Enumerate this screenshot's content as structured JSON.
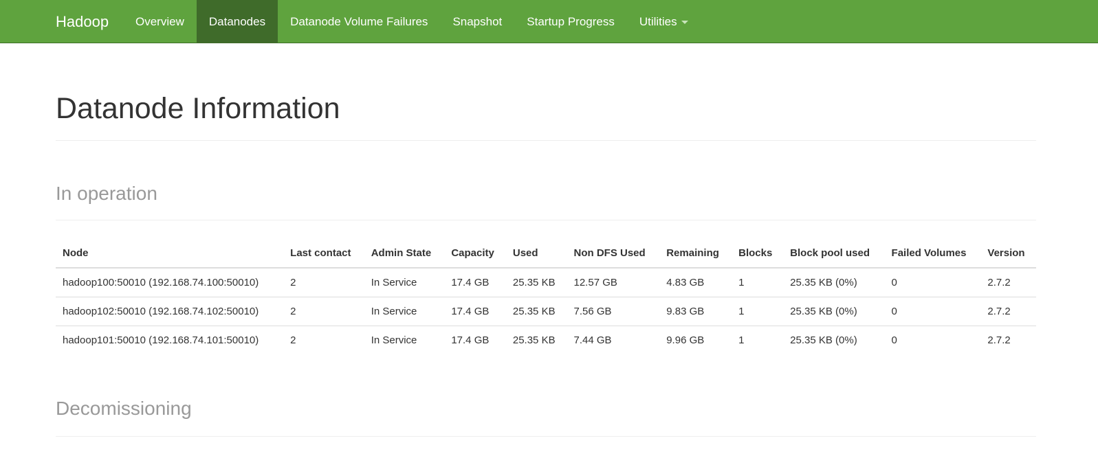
{
  "navbar": {
    "brand": "Hadoop",
    "items": [
      {
        "label": "Overview"
      },
      {
        "label": "Datanodes",
        "active": true
      },
      {
        "label": "Datanode Volume Failures"
      },
      {
        "label": "Snapshot"
      },
      {
        "label": "Startup Progress"
      },
      {
        "label": "Utilities",
        "has_dropdown": true
      }
    ]
  },
  "page": {
    "title": "Datanode Information"
  },
  "in_operation": {
    "title": "In operation",
    "columns": [
      "Node",
      "Last contact",
      "Admin State",
      "Capacity",
      "Used",
      "Non DFS Used",
      "Remaining",
      "Blocks",
      "Block pool used",
      "Failed Volumes",
      "Version"
    ],
    "rows": [
      [
        "hadoop100:50010 (192.168.74.100:50010)",
        "2",
        "In Service",
        "17.4 GB",
        "25.35 KB",
        "12.57 GB",
        "4.83 GB",
        "1",
        "25.35 KB (0%)",
        "0",
        "2.7.2"
      ],
      [
        "hadoop102:50010 (192.168.74.102:50010)",
        "2",
        "In Service",
        "17.4 GB",
        "25.35 KB",
        "7.56 GB",
        "9.83 GB",
        "1",
        "25.35 KB (0%)",
        "0",
        "2.7.2"
      ],
      [
        "hadoop101:50010 (192.168.74.101:50010)",
        "2",
        "In Service",
        "17.4 GB",
        "25.35 KB",
        "7.44 GB",
        "9.96 GB",
        "1",
        "25.35 KB (0%)",
        "0",
        "2.7.2"
      ]
    ]
  },
  "decommissioning": {
    "title": "Decomissioning"
  },
  "colors": {
    "navbar_bg": "#5fa33e",
    "navbar_active_bg": "#3f6b2a",
    "section_title": "#999999"
  }
}
